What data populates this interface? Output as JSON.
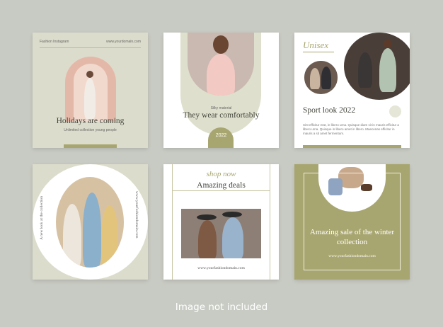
{
  "card1": {
    "brand": "Fashion Instagram",
    "domain": "www.yourdomain.com",
    "title": "Holidays are coming",
    "subtitle": "Unlimited collection young people"
  },
  "card2": {
    "subtitle": "Silky material",
    "title": "They wear comfortably",
    "year": "2022"
  },
  "card3": {
    "script": "Unisex",
    "title": "Sport look 2022",
    "body": "Sint efficitur erat, in libero urna. Quisque diam sit in mauris efficitur a libero urna. Quisque in libero amet in libero. Maecenas efficitur in mauris a sit amet fermentum."
  },
  "card4": {
    "left_text": "A new look at the collection",
    "right_text": "www.yourfashiondomain.com"
  },
  "card5": {
    "script": "shop now",
    "title": "Amazing deals",
    "domain": "www.yourfashiondomain.com"
  },
  "card6": {
    "title": "Amazing sale of the winter collection",
    "domain": "www.yourfashiondomain.com"
  },
  "caption": "Image not included",
  "colors": {
    "background": "#c8cbc3",
    "olive": "#a8a670",
    "sage": "#dcdccc",
    "text_dark": "#44463c"
  }
}
